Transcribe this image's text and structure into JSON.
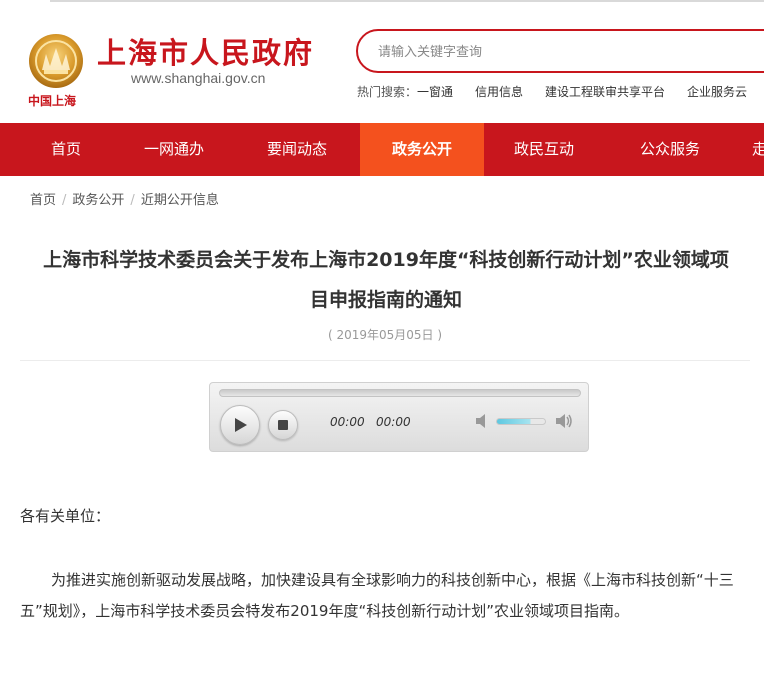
{
  "header": {
    "emblem_text": "中国上海",
    "title": "上海市人民政府",
    "url": "www.shanghai.gov.cn",
    "brand_color": "#c8161d"
  },
  "search": {
    "placeholder": "请输入关键字查询"
  },
  "hot_search": {
    "label": "热门搜索：",
    "links": [
      "一窗通",
      "信用信息",
      "建设工程联审共享平台",
      "企业服务云"
    ]
  },
  "nav": {
    "items": [
      "首页",
      "一网通办",
      "要闻动态",
      "政务公开",
      "政民互动",
      "公众服务",
      "走"
    ],
    "active": "政务公开",
    "active_color": "#f4511e"
  },
  "breadcrumb": [
    "首页",
    "政务公开",
    "近期公开信息"
  ],
  "article": {
    "title_line1": "上海市科学技术委员会关于发布上海市2019年度“科技创新行动计划”农业领域项",
    "title_line2": "目申报指南的通知",
    "date": "( 2019年05月05日 )",
    "salutation": "各有关单位：",
    "paragraph": "为推进实施创新驱动发展战略，加快建设具有全球影响力的科技创新中心，根据《上海市科技创新“十三五”规划》，上海市科学技术委员会特发布2019年度“科技创新行动计划”农业领域项目指南。"
  },
  "player": {
    "current_time": "00:00",
    "duration": "00:00",
    "play_icon": "play-icon",
    "stop_icon": "stop-icon",
    "volume_level": 0.7
  }
}
